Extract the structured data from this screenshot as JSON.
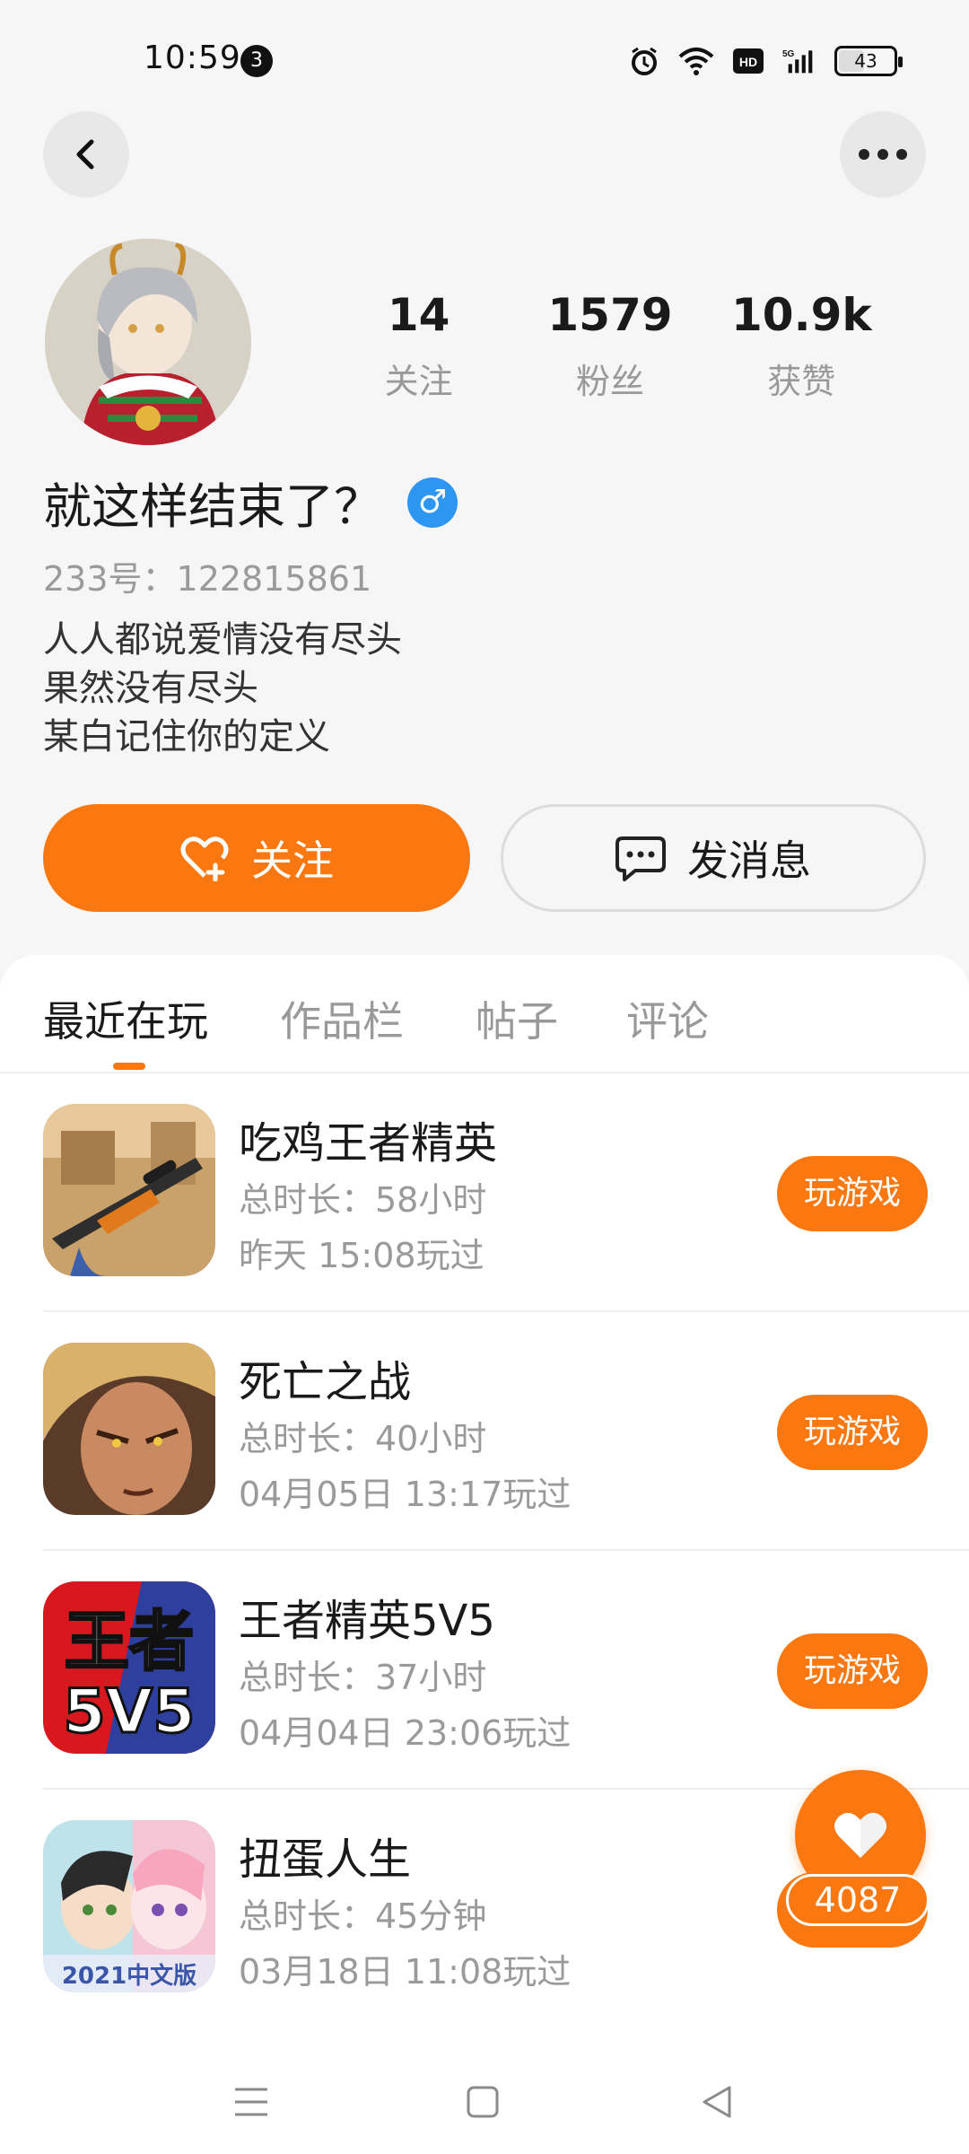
{
  "status_bar": {
    "time": "10:59",
    "notification_count": "3",
    "battery": "43",
    "icons": [
      "alarm-icon",
      "wifi-icon",
      "hd-icon",
      "5g-signal-icon",
      "battery-icon"
    ]
  },
  "profile": {
    "stats": [
      {
        "value": "14",
        "label": "关注"
      },
      {
        "value": "1579",
        "label": "粉丝"
      },
      {
        "value": "10.9k",
        "label": "获赞"
      }
    ],
    "nickname": "就这样结束了？",
    "gender_symbol": "♂",
    "uid": "233号：122815861",
    "bio_lines": [
      "人人都说爱情没有尽头",
      "果然没有尽头",
      "某白记住你的定义"
    ],
    "follow_label": "关注",
    "message_label": "发消息"
  },
  "tabs": [
    {
      "label": "最近在玩",
      "active": true
    },
    {
      "label": "作品栏",
      "active": false
    },
    {
      "label": "帖子",
      "active": false
    },
    {
      "label": "评论",
      "active": false
    }
  ],
  "games": [
    {
      "name": "吃鸡王者精英",
      "duration": "总时长：58小时",
      "last_played": "昨天 15:08玩过",
      "button": "玩游戏"
    },
    {
      "name": "死亡之战",
      "duration": "总时长：40小时",
      "last_played": "04月05日 13:17玩过",
      "button": "玩游戏"
    },
    {
      "name": "王者精英5V5",
      "duration": "总时长：37小时",
      "last_played": "04月04日 23:06玩过",
      "button": "玩游戏",
      "icon_text_top": "王者",
      "icon_text_bottom": "5V5"
    },
    {
      "name": "扭蛋人生",
      "duration": "总时长：45分钟",
      "last_played": "03月18日 11:08玩过",
      "button": "玩游戏",
      "icon_text": "2021中文版"
    }
  ],
  "float_like": {
    "count": "4087"
  },
  "colors": {
    "accent": "#fb7811",
    "gender": "#2d96f0",
    "muted": "#9a9a9a"
  }
}
